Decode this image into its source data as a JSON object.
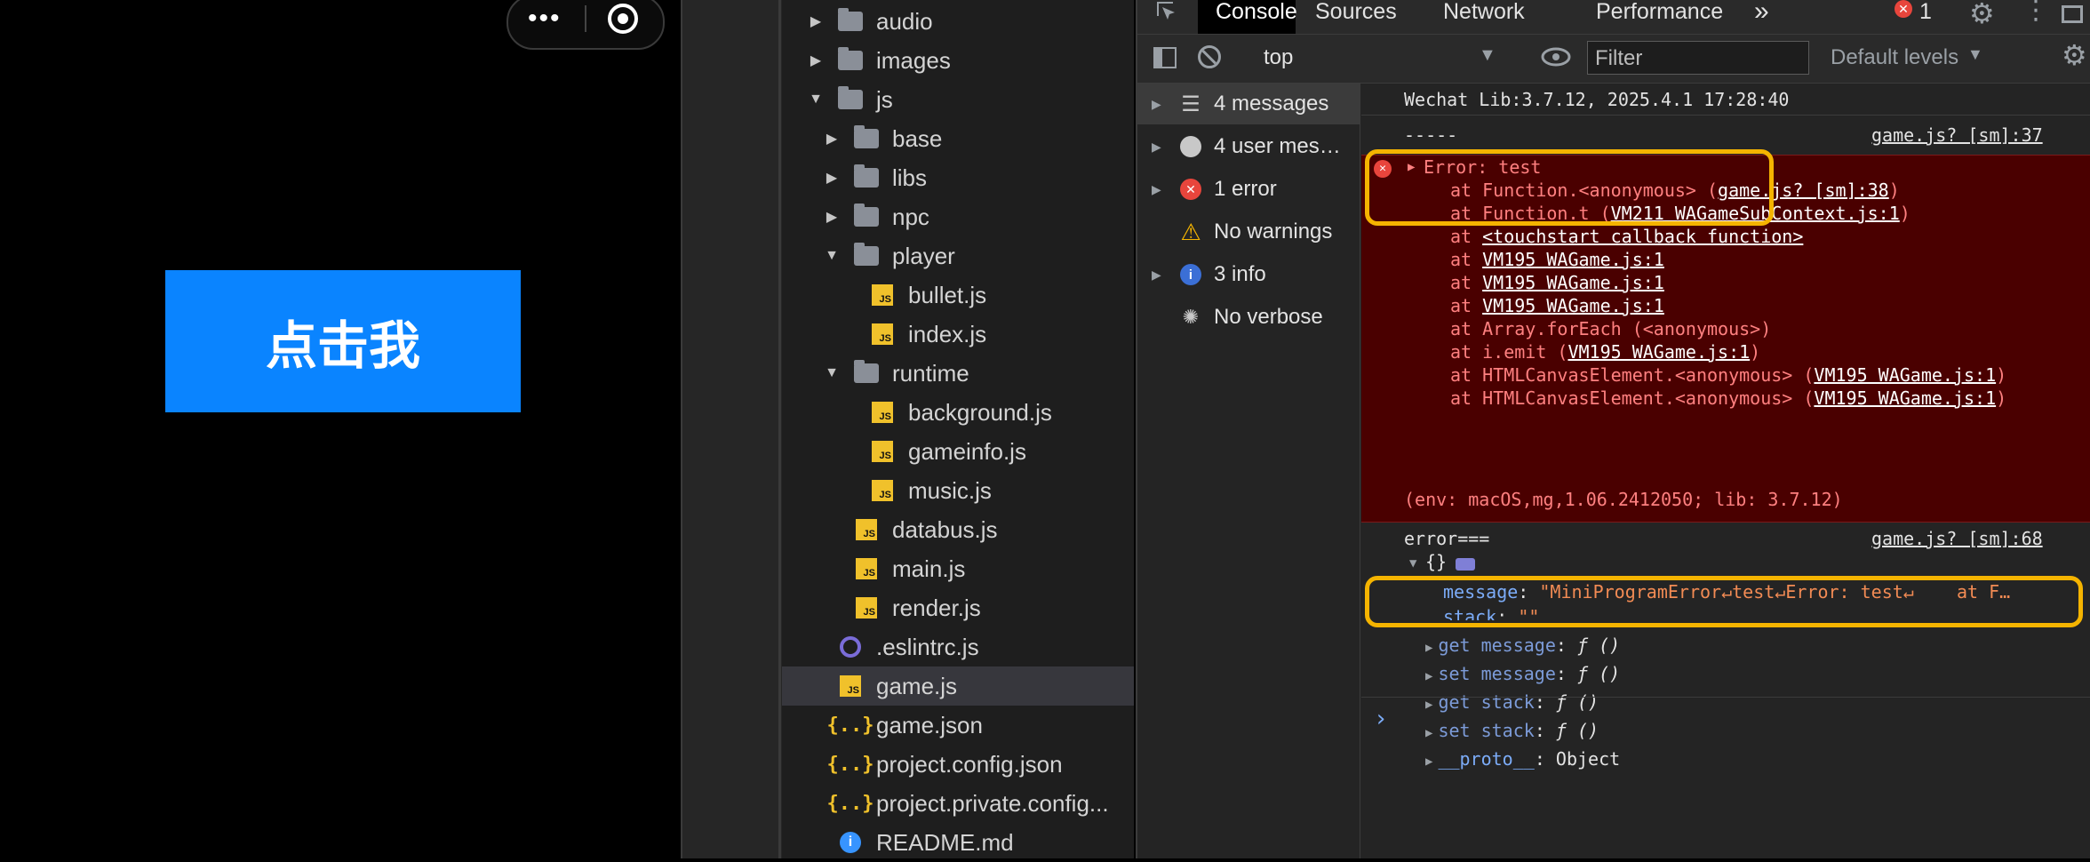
{
  "simulator": {
    "capsule_dots": "•••",
    "button_label": "点击我"
  },
  "file_tree": [
    {
      "label": "audio",
      "type": "folder",
      "expanded": false
    },
    {
      "label": "images",
      "type": "folder",
      "expanded": false
    },
    {
      "label": "js",
      "type": "folder",
      "expanded": true
    },
    {
      "label": "base",
      "type": "folder",
      "expanded": false
    },
    {
      "label": "libs",
      "type": "folder",
      "expanded": false
    },
    {
      "label": "npc",
      "type": "folder",
      "expanded": false
    },
    {
      "label": "player",
      "type": "folder",
      "expanded": true
    },
    {
      "label": "bullet.js",
      "type": "js"
    },
    {
      "label": "index.js",
      "type": "js"
    },
    {
      "label": "runtime",
      "type": "folder",
      "expanded": true
    },
    {
      "label": "background.js",
      "type": "js"
    },
    {
      "label": "gameinfo.js",
      "type": "js"
    },
    {
      "label": "music.js",
      "type": "js"
    },
    {
      "label": "databus.js",
      "type": "js"
    },
    {
      "label": "main.js",
      "type": "js"
    },
    {
      "label": "render.js",
      "type": "js"
    },
    {
      "label": ".eslintrc.js",
      "type": "eslint"
    },
    {
      "label": "game.js",
      "type": "js",
      "selected": true
    },
    {
      "label": "game.json",
      "type": "json"
    },
    {
      "label": "project.config.json",
      "type": "json"
    },
    {
      "label": "project.private.config...",
      "type": "json"
    },
    {
      "label": "README.md",
      "type": "info"
    }
  ],
  "devtools": {
    "tabs": [
      "Console",
      "Sources",
      "Network",
      "Performance"
    ],
    "more_tabs": "»",
    "error_count": "1",
    "context": "top",
    "filter_placeholder": "Filter",
    "levels": "Default levels",
    "sidebar": [
      {
        "label": "4 messages",
        "icon": "list-icon",
        "selected": true
      },
      {
        "label": "4 user mes…",
        "icon": "user-icon"
      },
      {
        "label": "1 error",
        "icon": "error-icon"
      },
      {
        "label": "No warnings",
        "icon": "warning-icon"
      },
      {
        "label": "3 info",
        "icon": "info-icon"
      },
      {
        "label": "No verbose",
        "icon": "bug-icon"
      }
    ],
    "log": {
      "lib_line": "Wechat Lib:3.7.12, 2025.4.1 17:28:40",
      "dashes": "-----",
      "src1": "game.js? [sm]:37",
      "error_title": "Error: test",
      "stack": [
        {
          "pre": "at Function.<anonymous> (",
          "link": "game.js? [sm]:38",
          "post": ")"
        },
        {
          "pre": "at Function.t (",
          "link": "VM211 WAGameSubContext.js:1",
          "post": ")"
        },
        {
          "pre": "at ",
          "link": "<touchstart callback function>",
          "post": ""
        },
        {
          "pre": "at ",
          "link": "VM195 WAGame.js:1",
          "post": ""
        },
        {
          "pre": "at ",
          "link": "VM195 WAGame.js:1",
          "post": ""
        },
        {
          "pre": "at ",
          "link": "VM195 WAGame.js:1",
          "post": ""
        },
        {
          "pre": "at Array.forEach (<anonymous>)",
          "link": "",
          "post": ""
        },
        {
          "pre": "at i.emit (",
          "link": "VM195 WAGame.js:1",
          "post": ")"
        },
        {
          "pre": "at HTMLCanvasElement.<anonymous> (",
          "link": "VM195 WAGame.js:1",
          "post": ")"
        },
        {
          "pre": "at HTMLCanvasElement.<anonymous> (",
          "link": "VM195 WAGame.js:1",
          "post": ")"
        }
      ],
      "env_line": "(env: macOS,mg,1.06.2412050; lib: 3.7.12)",
      "error_eq": "error===",
      "src2": "game.js? [sm]:68",
      "obj_open": "{}",
      "message_key": "message",
      "message_val": "\"MiniProgramError↵test↵Error: test↵    at F…",
      "stack_key": "stack",
      "stack_val": "\"\"",
      "accessors": [
        {
          "key": "get message",
          "val": "ƒ ()"
        },
        {
          "key": "set message",
          "val": "ƒ ()"
        },
        {
          "key": "get stack",
          "val": "ƒ ()"
        },
        {
          "key": "set stack",
          "val": "ƒ ()"
        },
        {
          "key": "__proto__",
          "val": "Object"
        }
      ],
      "prompt": "›"
    }
  },
  "colors": {
    "button_blue": "#0a84ff",
    "error_bg": "#4a0000",
    "error_text": "#ff8080",
    "highlight": "#f5b400",
    "link_blue": "#7cacf8",
    "key_purple": "#7cacf8"
  }
}
